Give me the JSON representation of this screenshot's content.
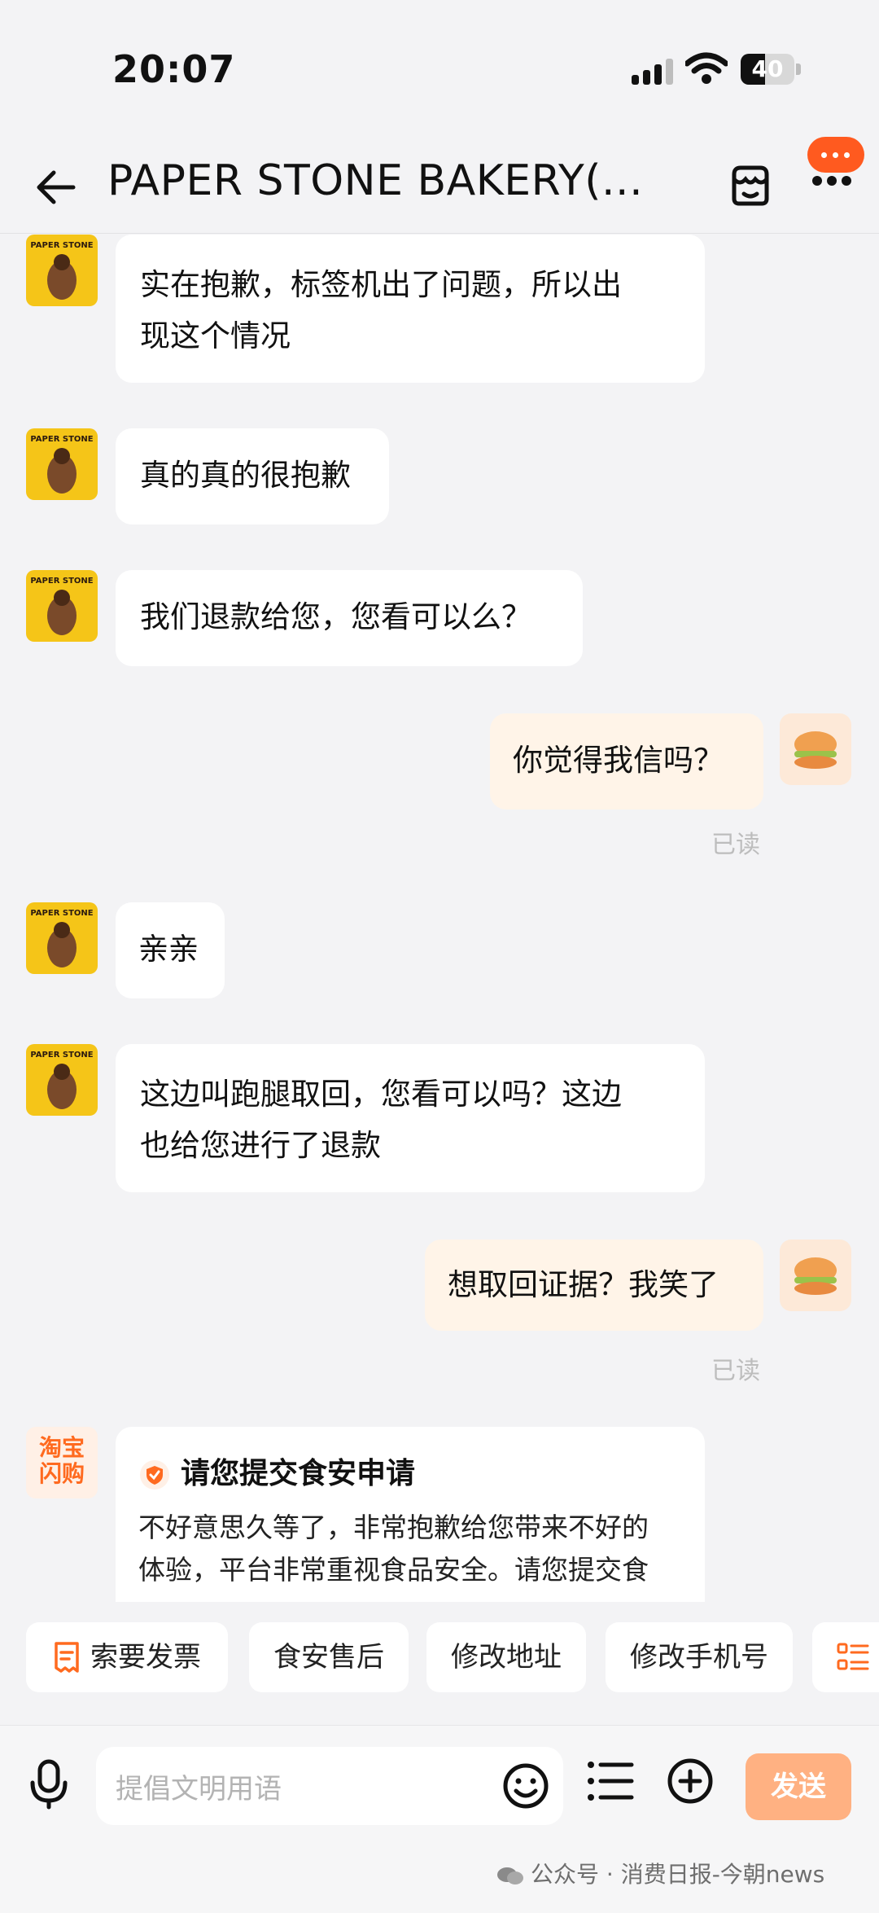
{
  "status_bar": {
    "time": "20:07",
    "battery": "40"
  },
  "header": {
    "title": "PAPER STONE BAKERY(..."
  },
  "shop_avatar_text": "PAPER STONE",
  "messages": [
    {
      "from": "shop",
      "lines": [
        "实在抱歉，标签机出了问题，所以出",
        "现这个情况"
      ]
    },
    {
      "from": "shop",
      "lines": [
        "真的真的很抱歉"
      ]
    },
    {
      "from": "shop",
      "lines": [
        "我们退款给您，您看可以么？"
      ]
    },
    {
      "from": "me",
      "lines": [
        "你觉得我信吗？"
      ],
      "read": "已读"
    },
    {
      "from": "shop",
      "lines": [
        "亲亲"
      ]
    },
    {
      "from": "shop",
      "lines": [
        "这边叫跑腿取回，您看可以吗？这边",
        "也给您进行了退款"
      ]
    },
    {
      "from": "me",
      "lines": [
        "想取回证据？我笑了"
      ],
      "read": "已读"
    }
  ],
  "system_card": {
    "logo_text": "淘宝闪购",
    "title": "请您提交食安申请",
    "body_lines": [
      "不好意思久等了，非常抱歉给您带来不好的",
      "体验，平台非常重视食品安全。请您提交食"
    ]
  },
  "quick_actions": [
    "索要发票",
    "食安售后",
    "修改地址",
    "修改手机号"
  ],
  "composer": {
    "placeholder": "提倡文明用语",
    "send": "发送"
  },
  "watermark": "公众号 · 消费日报-今朝news",
  "colors": {
    "accent": "#ff6a1f",
    "send_bg": "#ffb182",
    "my_bubble": "#fff4e8",
    "background": "#f3f3f5"
  }
}
